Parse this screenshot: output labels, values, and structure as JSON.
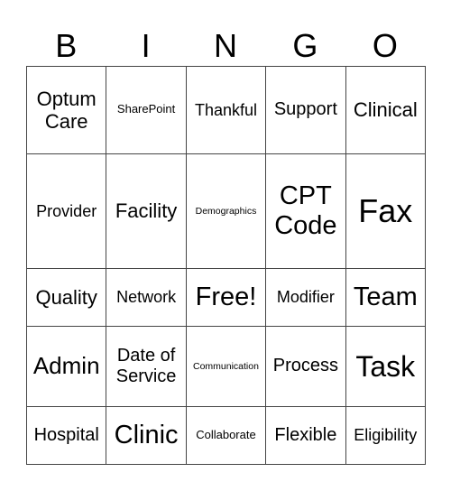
{
  "header": [
    "B",
    "I",
    "N",
    "G",
    "O"
  ],
  "rows": [
    [
      "Optum Care",
      "SharePoint",
      "Thankful",
      "Support",
      "Clinical"
    ],
    [
      "Provider",
      "Facility",
      "Demographics",
      "CPT Code",
      "Fax"
    ],
    [
      "Quality",
      "Network",
      "Free!",
      "Modifier",
      "Team"
    ],
    [
      "Admin",
      "Date of Service",
      "Communication",
      "Process",
      "Task"
    ],
    [
      "Hospital",
      "Clinic",
      "Collaborate",
      "Flexible",
      "Eligibility"
    ]
  ]
}
